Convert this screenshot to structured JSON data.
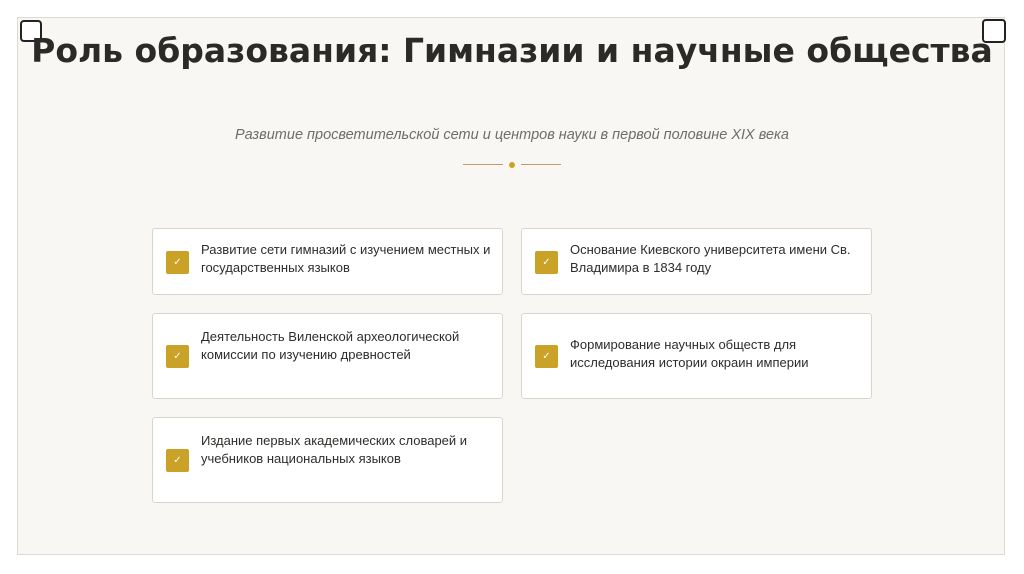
{
  "slide": {
    "title": "Роль образования: Гимназии и научные общества",
    "subtitle": "Развитие просветительской сети и центров науки в первой половине XIX века",
    "accent_color": "#c9a227",
    "divider_color": "#c69a6a",
    "check_icon": "check-icon",
    "check_glyph": "✓",
    "items": [
      {
        "text": "Развитие сети гимназий с изучением местных и государственных языков"
      },
      {
        "text": "Основание Киевского университета имени Св. Владимира в 1834 году"
      },
      {
        "text": "Деятельность Виленской археологической комиссии по изучению древностей"
      },
      {
        "text": "Формирование научных обществ для исследования истории окраин империи"
      },
      {
        "text": "Издание первых академических словарей и учебников национальных языков"
      }
    ]
  }
}
